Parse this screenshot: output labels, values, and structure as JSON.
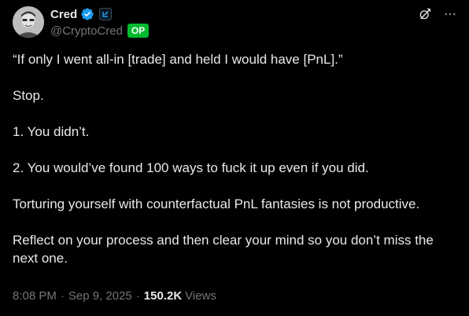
{
  "author": {
    "display_name": "Cred",
    "handle": "@CryptoCred",
    "op_badge": "OP",
    "avatar_icon": "user-avatar",
    "verified_color": "#1d9bf0"
  },
  "actions": {
    "grok_icon": "grok-icon",
    "more_icon": "more-options-icon"
  },
  "body": {
    "paragraphs": [
      "“If only I went all-in [trade] and held I would have [PnL].”",
      "Stop.",
      "1. You didn’t.",
      "2. You would’ve found 100 ways to fuck it up even if you did.",
      "Torturing yourself with counterfactual PnL fantasies is not productive.",
      "Reflect on your process and then clear your mind so you don’t miss the next one."
    ]
  },
  "meta": {
    "time": "8:08 PM",
    "date": "Sep 9, 2025",
    "views_count": "150.2K",
    "views_label": "Views",
    "separator": "·"
  },
  "colors": {
    "background": "#000000",
    "text_primary": "#e7e9ea",
    "text_secondary": "#71767b",
    "op_badge_bg": "#00ba2e"
  }
}
